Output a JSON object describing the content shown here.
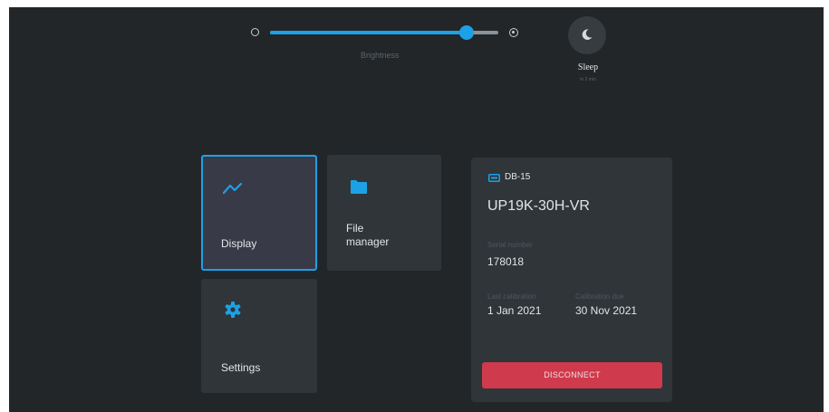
{
  "brightness": {
    "label": "Brightness",
    "level": 0.86,
    "accent_color": "#1da1e6",
    "min_icon": "brightness-low-icon",
    "max_icon": "brightness-high-icon"
  },
  "sleep": {
    "label": "Sleep",
    "sublabel": "in 2 min",
    "icon": "moon-icon"
  },
  "tiles": {
    "display": {
      "label": "Display",
      "icon": "trend-line-icon"
    },
    "file_manager": {
      "label_line1": "File",
      "label_line2": "manager",
      "icon": "folder-icon"
    },
    "settings": {
      "label": "Settings",
      "icon": "gear-icon"
    }
  },
  "device": {
    "port_label": "DB-15",
    "port_icon": "vga-port-icon",
    "model": "UP19K-30H-VR",
    "serial_label": "Serial number",
    "serial_value": "178018",
    "last_cal_label": "Last calibration",
    "last_cal_value": "1 Jan 2021",
    "cal_due_label": "Calibration due",
    "cal_due_value": "30 Nov 2021",
    "disconnect_label": "DISCONNECT",
    "disconnect_color": "#cf3a4c"
  }
}
